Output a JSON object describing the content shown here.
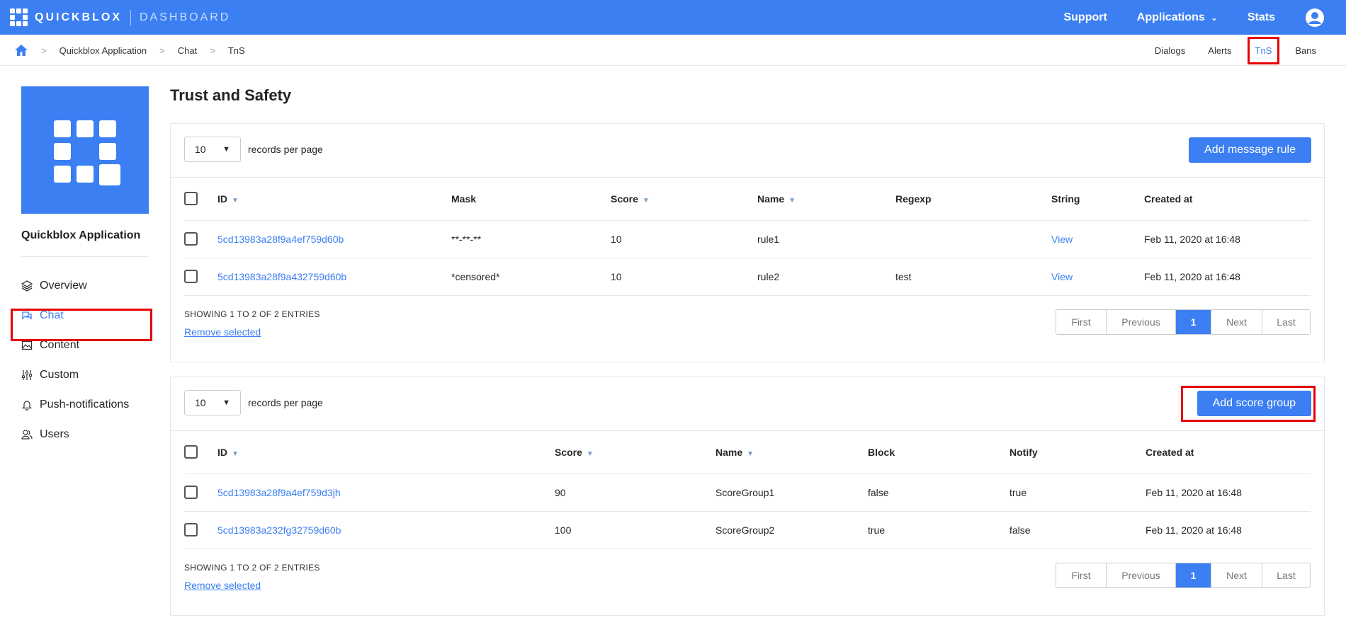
{
  "topbar": {
    "brand": "QUICKBLOX",
    "brand_sub": "DASHBOARD",
    "nav": {
      "support": "Support",
      "applications": "Applications",
      "stats": "Stats"
    },
    "icons": {
      "user": "user-circle-icon",
      "chevron": "chevron-down-icon"
    }
  },
  "breadcrumb": {
    "items": [
      "Quickblox Application",
      "Chat",
      "TnS"
    ],
    "tabs": [
      "Dialogs",
      "Alerts",
      "TnS",
      "Bans"
    ],
    "active_tab": "TnS"
  },
  "sidebar": {
    "app_name": "Quickblox Application",
    "items": [
      {
        "label": "Overview",
        "icon": "layers-icon"
      },
      {
        "label": "Chat",
        "icon": "chat-bubbles-icon"
      },
      {
        "label": "Content",
        "icon": "image-icon"
      },
      {
        "label": "Custom",
        "icon": "sliders-icon"
      },
      {
        "label": "Push-notifications",
        "icon": "bell-icon"
      },
      {
        "label": "Users",
        "icon": "users-icon"
      }
    ],
    "active": "Chat"
  },
  "main": {
    "title": "Trust and Safety",
    "rules": {
      "per_page": "10",
      "per_page_label": "records per page",
      "add_button": "Add message rule",
      "columns": [
        "ID",
        "Mask",
        "Score",
        "Name",
        "Regexp",
        "String",
        "Created at"
      ],
      "rows": [
        {
          "id": "5cd13983a28f9a4ef759d60b",
          "mask": "**-**-**",
          "score": "10",
          "name": "rule1",
          "regexp": "",
          "string": "View",
          "created": "Feb 11, 2020 at 16:48"
        },
        {
          "id": "5cd13983a28f9a432759d60b",
          "mask": "*censored*",
          "score": "10",
          "name": "rule2",
          "regexp": "test",
          "string": "View",
          "created": "Feb 11, 2020 at 16:48"
        }
      ],
      "showing": "SHOWING 1 TO 2 OF 2 ENTRIES",
      "remove_selected": "Remove selected",
      "pager": [
        "First",
        "Previous",
        "1",
        "Next",
        "Last"
      ]
    },
    "groups": {
      "per_page": "10",
      "per_page_label": "records per page",
      "add_button": "Add score group",
      "columns": [
        "ID",
        "Score",
        "Name",
        "Block",
        "Notify",
        "Created at"
      ],
      "rows": [
        {
          "id": "5cd13983a28f9a4ef759d3jh",
          "score": "90",
          "name": "ScoreGroup1",
          "block": "false",
          "notify": "true",
          "created": "Feb 11, 2020 at 16:48"
        },
        {
          "id": "5cd13983a232fg32759d60b",
          "score": "100",
          "name": "ScoreGroup2",
          "block": "true",
          "notify": "false",
          "created": "Feb 11, 2020 at 16:48"
        }
      ],
      "showing": "SHOWING 1 TO 2 OF 2 ENTRIES",
      "remove_selected": "Remove selected",
      "pager": [
        "First",
        "Previous",
        "1",
        "Next",
        "Last"
      ]
    }
  },
  "colors": {
    "accent": "#3b7ff2",
    "highlight": "#e60000"
  }
}
